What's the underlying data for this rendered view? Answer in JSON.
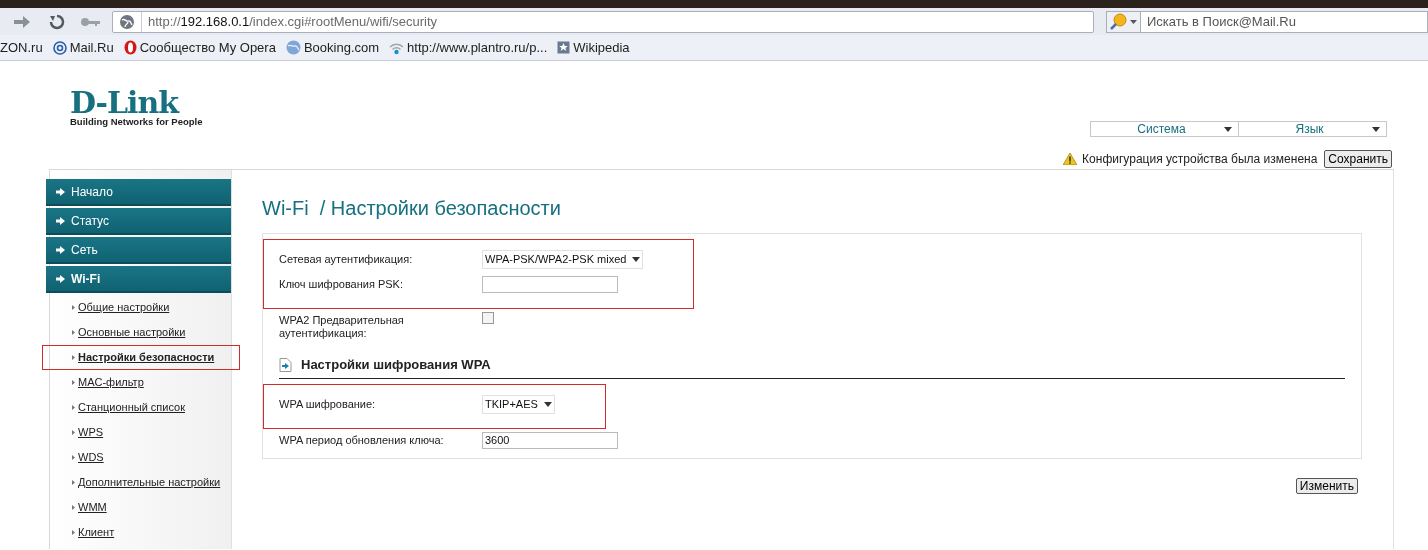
{
  "browser": {
    "address": {
      "scheme": "http://",
      "host": "192.168.0.1",
      "path": "/index.cgi#rootMenu/wifi/security"
    },
    "search": {
      "placeholder": "Искать в Поиск@Mail.Ru"
    },
    "bookmarks": [
      {
        "label": "ZON.ru",
        "kind": "plain"
      },
      {
        "label": "Mail.Ru",
        "kind": "at"
      },
      {
        "label": "Сообщество My Opera",
        "kind": "opera"
      },
      {
        "label": "Booking.com",
        "kind": "globe"
      },
      {
        "label": "http://www.plantro.ru/p...",
        "kind": "signal"
      },
      {
        "label": "Wikipedia",
        "kind": "star"
      }
    ]
  },
  "logo": {
    "brand": "D-Link",
    "tagline": "Building Networks for People"
  },
  "top_menus": [
    {
      "label": "Система"
    },
    {
      "label": "Язык"
    }
  ],
  "notice": {
    "text": "Конфигурация устройства была изменена",
    "button": "Сохранить"
  },
  "sidebar": {
    "items": [
      {
        "label": "Начало",
        "expanded": false
      },
      {
        "label": "Статус",
        "expanded": false
      },
      {
        "label": "Сеть",
        "expanded": false
      },
      {
        "label": "Wi-Fi",
        "expanded": true,
        "children": [
          {
            "label": "Общие настройки",
            "selected": false,
            "highlighted": false
          },
          {
            "label": "Основные настройки",
            "selected": false,
            "highlighted": false
          },
          {
            "label": "Настройки безопасности",
            "selected": true,
            "highlighted": true
          },
          {
            "label": "MAC-фильтр",
            "selected": false,
            "highlighted": false
          },
          {
            "label": "Станционный список",
            "selected": false,
            "highlighted": false
          },
          {
            "label": "WPS",
            "selected": false,
            "highlighted": false
          },
          {
            "label": "WDS",
            "selected": false,
            "highlighted": false
          },
          {
            "label": "Дополнительные настройки",
            "selected": false,
            "highlighted": false
          },
          {
            "label": "WMM",
            "selected": false,
            "highlighted": false
          },
          {
            "label": "Клиент",
            "selected": false,
            "highlighted": false
          }
        ]
      }
    ]
  },
  "title": "Wi-Fi  / Настройки безопасности",
  "form": {
    "blocks": [
      {
        "kind": "group",
        "highlighted": true,
        "rows": [
          {
            "kind": "select",
            "label": "Сетевая аутентификация:",
            "value": "WPA-PSK/WPA2-PSK mixed"
          },
          {
            "kind": "input",
            "label": "Ключ шифрования PSK:"
          }
        ]
      },
      {
        "kind": "group",
        "highlighted": false,
        "rows": [
          {
            "kind": "checkbox",
            "label": "WPA2 Предварительная аутентификация:",
            "checked": false
          }
        ]
      },
      {
        "kind": "section",
        "label": "Настройки шифрования WPA"
      },
      {
        "kind": "group",
        "highlighted": true,
        "rows": [
          {
            "kind": "select",
            "label": "WPA шифрование:",
            "value": "TKIP+AES"
          }
        ]
      },
      {
        "kind": "group",
        "highlighted": false,
        "rows": [
          {
            "kind": "input",
            "label": "WPA период обновления ключа:",
            "value": "3600"
          }
        ]
      }
    ]
  },
  "apply_button": "Изменить"
}
